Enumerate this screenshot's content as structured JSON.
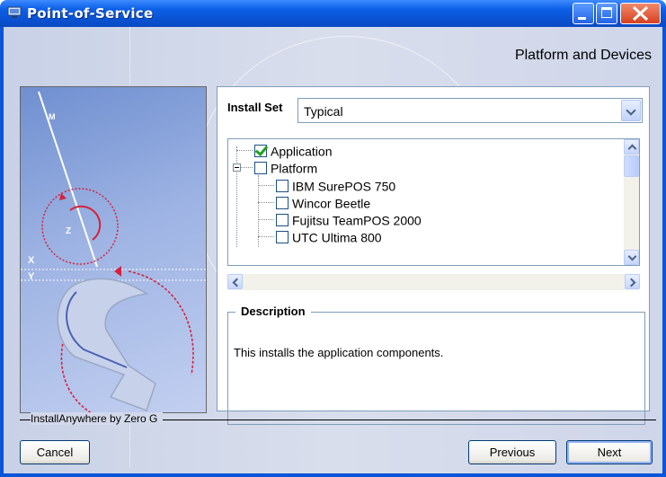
{
  "window": {
    "title": "Point-of-Service",
    "step_title": "Platform and Devices"
  },
  "install_set": {
    "label": "Install Set",
    "selected": "Typical"
  },
  "tree": {
    "items": [
      {
        "label": "Application",
        "checked": true
      },
      {
        "label": "Platform",
        "checked": false
      },
      {
        "label": "IBM SurePOS 750",
        "checked": false
      },
      {
        "label": "Wincor Beetle",
        "checked": false
      },
      {
        "label": "Fujitsu TeamPOS 2000",
        "checked": false
      },
      {
        "label": "UTC Ultima 800",
        "checked": false
      }
    ]
  },
  "description": {
    "title": "Description",
    "text": "This installs the application components."
  },
  "side_image": {
    "letter_m": "M",
    "letter_z": "Z",
    "letter_x": "X",
    "letter_y": "Y"
  },
  "footer": {
    "vendor": "InstallAnywhere by Zero G",
    "cancel": "Cancel",
    "previous": "Previous",
    "next": "Next"
  },
  "colors": {
    "titlebar": "#0b55d9",
    "accent_red": "#d8203a"
  }
}
